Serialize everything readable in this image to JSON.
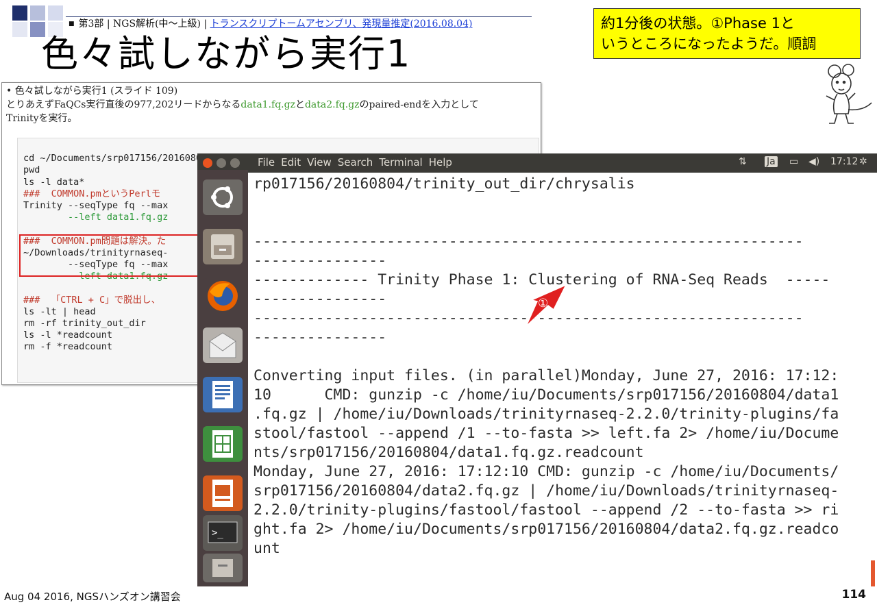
{
  "breadcrumb": {
    "bullet": "■",
    "part": "第3部 | NGS解析(中～上級) | ",
    "link": "トランスクリプトームアセンブリ、発現量推定(2016.08.04)"
  },
  "title": "色々試しながら実行1",
  "callout": {
    "line1": "約1分後の状態。①Phase 1と",
    "line2": "いうところになったようだ。順調"
  },
  "panel": {
    "bullet_line": "• 色々試しながら実行1 (スライド 109)",
    "desc_pre": "とりあえずFaQCs実行直後の977,202リードからなる",
    "file1": "data1.fq.gz",
    "and": "と",
    "file2": "data2.fq.gz",
    "desc_post": "のpaired-endを入力として",
    "desc_line2": "Trinityを実行。",
    "code_lines": [
      "cd ~/Documents/srp017156/20160804",
      "pwd",
      "ls -l data*",
      "###  COMMON.pmというPerlモ",
      "Trinity --seqType fq --max",
      "        --left data1.fq.gz",
      "",
      "###  COMMON.pm問題は解決。た",
      "~/Downloads/trinityrnaseq-",
      "        --seqType fq --max",
      "        --left data1.fq.gz",
      "",
      "###  「CTRL + C」で脱出し、",
      "ls -lt | head",
      "rm -rf trinity_out_dir",
      "ls -l *readcount",
      "rm -f *readcount"
    ]
  },
  "terminal": {
    "menu": [
      "File",
      "Edit",
      "View",
      "Search",
      "Terminal",
      "Help"
    ],
    "tray": {
      "ime": "Ja",
      "clock": "17:12"
    },
    "lines": [
      "rp017156/20160804/trinity_out_dir/chrysalis",
      "",
      "",
      "--------------------------------------------------------------",
      "---------------",
      "------------- Trinity Phase 1: Clustering of RNA-Seq Reads  -----",
      "---------------",
      "--------------------------------------------------------------",
      "---------------",
      "",
      "Converting input files. (in parallel)Monday, June 27, 2016: 17:12:",
      "10      CMD: gunzip -c /home/iu/Documents/srp017156/20160804/data1",
      ".fq.gz | /home/iu/Downloads/trinityrnaseq-2.2.0/trinity-plugins/fa",
      "stool/fastool --append /1 --to-fasta >> left.fa 2> /home/iu/Docume",
      "nts/srp017156/20160804/data1.fq.gz.readcount",
      "Monday, June 27, 2016: 17:12:10 CMD: gunzip -c /home/iu/Documents/",
      "srp017156/20160804/data2.fq.gz | /home/iu/Downloads/trinityrnaseq-",
      "2.2.0/trinity-plugins/fastool/fastool --append /2 --to-fasta >> ri",
      "ght.fa 2> /home/iu/Documents/srp017156/20160804/data2.fq.gz.readco",
      "unt"
    ]
  },
  "annotation": {
    "marker": "①"
  },
  "footer": {
    "left": "Aug 04 2016, NGSハンズオン講習会",
    "page": "114"
  },
  "colors": {
    "callout_bg": "#ffff00",
    "accent_navy": "#1f2f6b",
    "arrow_red": "#e02020",
    "launcher_bg": "#4a3f40"
  }
}
